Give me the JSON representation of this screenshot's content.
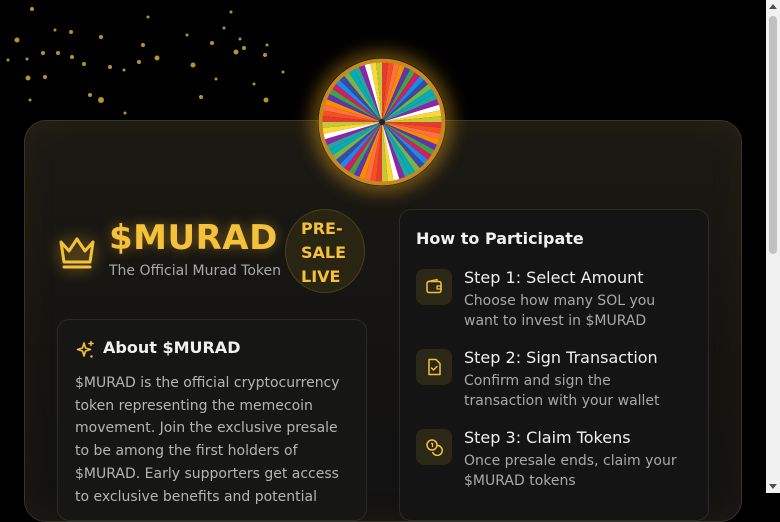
{
  "brand": {
    "title": "$MURAD",
    "subtitle": "The Official Murad Token",
    "badge_lines": [
      "PRE-",
      "SALE",
      "LIVE"
    ]
  },
  "about": {
    "title": "About $MURAD",
    "body": "$MURAD is the official cryptocurrency token representing the memecoin movement. Join the exclusive presale to be among the first holders of $MURAD. Early supporters get access to exclusive benefits and potential"
  },
  "participate": {
    "title": "How to Participate",
    "steps": [
      {
        "title": "Step 1: Select Amount",
        "desc": "Choose how many SOL you want to invest in $MURAD",
        "icon": "wallet-icon"
      },
      {
        "title": "Step 2: Sign Transaction",
        "desc": "Confirm and sign the transaction with your wallet",
        "icon": "file-check-icon"
      },
      {
        "title": "Step 3: Claim Tokens",
        "desc": "Once presale ends, claim your $MURAD tokens",
        "icon": "coins-icon"
      }
    ]
  },
  "colors": {
    "accent": "#f5c13a",
    "background": "#000000",
    "card": "#161614"
  },
  "icons": {
    "crown": "crown-icon",
    "about": "sparkles-icon",
    "wheel": "prize-wheel"
  }
}
